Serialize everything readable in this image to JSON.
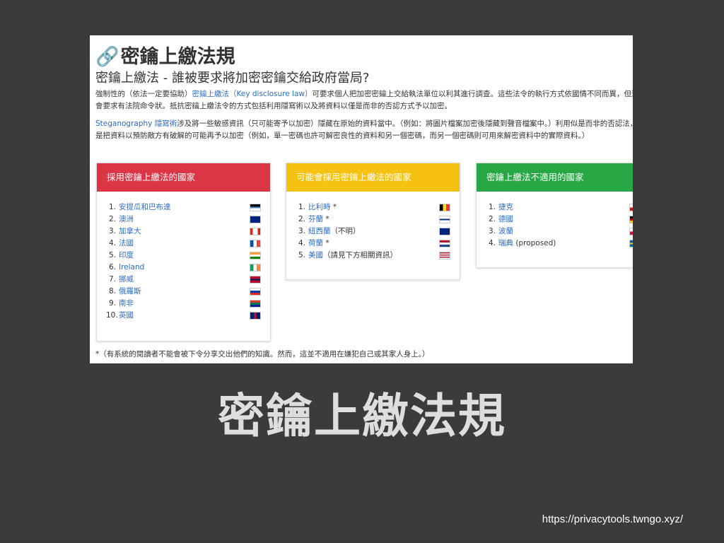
{
  "screenshot": {
    "h1": "密鑰上繳法規",
    "h2": "密鑰上繳法 - 誰被要求將加密密鑰交給政府當局?",
    "para1": {
      "a": "強制性的（依法一定要協助）",
      "link": "密鑰上繳法（Key disclosure law）",
      "b": "可要求個人把加密密鑰上交給執法單位以利其進行調查。這些法令的執行方式依國情不同而異，但通常會要求有法院命令狀。抵抗密鑰上繳法令的方式包括利用隱寫術以及將資料以僅是而非的否認方式予以加密。"
    },
    "para2": {
      "link": "Steganography 隱寫術",
      "b": "涉及將一些敏感資訊（只可能寄予以加密）隱藏在原始的資料當中。（例如：將圖片檔案加密後隱藏到聲音檔案中。）利用似是而非的否認法，則是把資料以預防敵方有破解的可能再予以加密（例如，單一密碼也許可解密良性的資料和另一個密碼，而另一個密碼則可用來解密資料中的實際資料。）"
    },
    "cards": [
      {
        "title": "採用密鑰上繳法的國家",
        "items": [
          {
            "n": "1.",
            "name": "安提瓜和巴布達",
            "note": ""
          },
          {
            "n": "2.",
            "name": "澳洲",
            "note": ""
          },
          {
            "n": "3.",
            "name": "加拿大",
            "note": ""
          },
          {
            "n": "4.",
            "name": "法國",
            "note": ""
          },
          {
            "n": "5.",
            "name": "印度",
            "note": ""
          },
          {
            "n": "6.",
            "name": "Ireland",
            "note": ""
          },
          {
            "n": "7.",
            "name": "挪威",
            "note": ""
          },
          {
            "n": "8.",
            "name": "俄羅斯",
            "note": ""
          },
          {
            "n": "9.",
            "name": "南非",
            "note": ""
          },
          {
            "n": "10.",
            "name": "英國",
            "note": ""
          }
        ]
      },
      {
        "title": "可能會採用密鑰上繳法的國家",
        "items": [
          {
            "n": "1.",
            "name": "比利時",
            "note": " *"
          },
          {
            "n": "2.",
            "name": "芬蘭",
            "note": " *"
          },
          {
            "n": "3.",
            "name": "紐西蘭",
            "note": "（不明）"
          },
          {
            "n": "4.",
            "name": "荷蘭",
            "note": " *"
          },
          {
            "n": "5.",
            "name": "美國",
            "note": "（請見下方相關資訊）"
          }
        ]
      },
      {
        "title": "密鑰上繳法不適用的國家",
        "items": [
          {
            "n": "1.",
            "name": "捷克",
            "note": ""
          },
          {
            "n": "2.",
            "name": "德國",
            "note": ""
          },
          {
            "n": "3.",
            "name": "波蘭",
            "note": ""
          },
          {
            "n": "4.",
            "name": "瑞典",
            "note": " (proposed)"
          }
        ]
      }
    ],
    "footnote": "*（有系統的閱讀者不能會被下令分享交出他們的知識。然而，這並不適用在嫌犯自己或其家人身上。）"
  },
  "slide_title": "密鑰上繳法規",
  "url": "https://privacytools.twngo.xyz/",
  "colors": {
    "card_red": "#dc3545",
    "card_yellow": "#f5c211",
    "card_green": "#28a745",
    "link": "#2a6cc4",
    "slide_bg": "#3b3b3b"
  }
}
